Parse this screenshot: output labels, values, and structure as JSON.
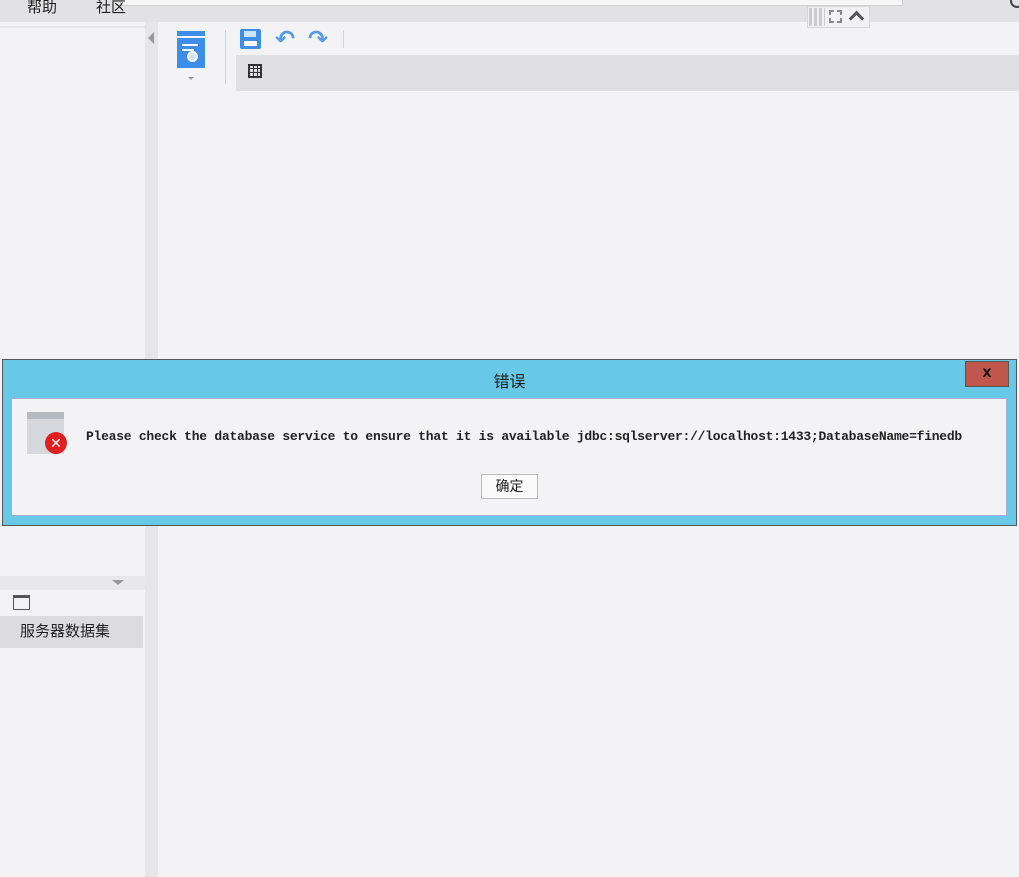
{
  "menu": {
    "items": [
      {
        "label": "帮助"
      },
      {
        "label": "社区"
      }
    ]
  },
  "left_panel": {
    "dataset_item": "服务器数据集"
  },
  "dialog": {
    "title": "错误",
    "close_label": "x",
    "message": "Please check the database service to ensure that it is available jdbc:sqlserver://localhost:1433;DatabaseName=finedb",
    "ok_label": "确定"
  },
  "colors": {
    "dialog_title_bg": "#67c8e8",
    "close_bg": "#c0574c",
    "toolbar_icon": "#3d8ee8",
    "error_red": "#e02020"
  }
}
